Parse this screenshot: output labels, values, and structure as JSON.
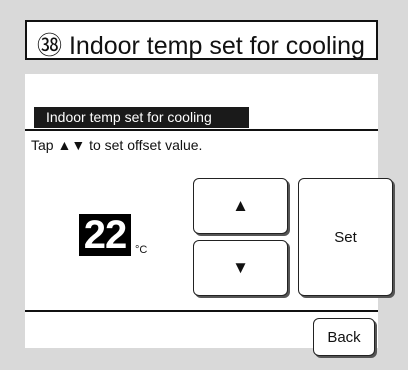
{
  "screen": {
    "number_badge": "㊳",
    "title": "Indoor temp set for cooling"
  },
  "panel": {
    "section_header": "Indoor temp set for cooling",
    "hint": "Tap ▲▼ to set offset value.",
    "value": "22",
    "unit": "°C"
  },
  "buttons": {
    "up_icon": "▲",
    "down_icon": "▼",
    "set_label": "Set",
    "back_label": "Back"
  },
  "colors": {
    "background": "#d9d9d9",
    "panel": "#ffffff",
    "header": "#1a1a1a",
    "value_box": "#000000"
  }
}
